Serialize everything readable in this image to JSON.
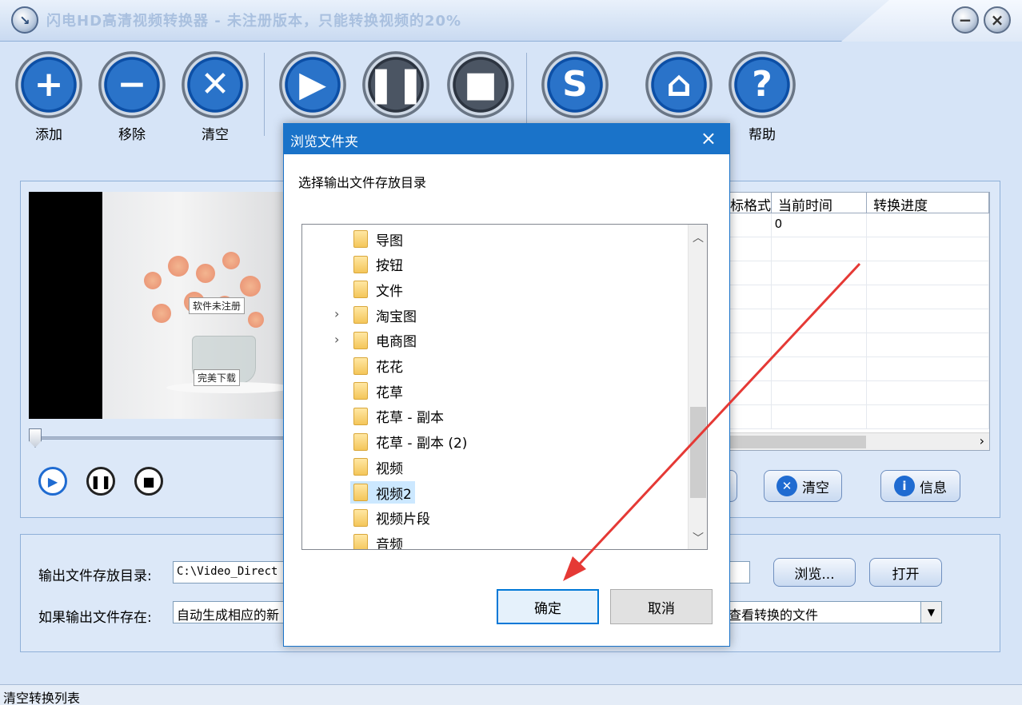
{
  "window": {
    "title": "闪电HD高清视频转换器 - 未注册版本，只能转换视频的20%",
    "icon": "app-logo-icon"
  },
  "toolbar": {
    "add_label": "添加",
    "remove_label": "移除",
    "clear_label": "清空",
    "help_label": "帮助"
  },
  "preview": {
    "watermark_top": "软件未注册",
    "watermark_bottom": "完美下载"
  },
  "filelist": {
    "columns": [
      "标格式",
      "当前时间",
      "转换进度"
    ],
    "rows": [
      {
        "format": "",
        "time": "0",
        "progress": ""
      }
    ]
  },
  "listbuttons": {
    "clear_label": "清空",
    "info_label": "信息"
  },
  "output": {
    "dir_label": "输出文件存放目录:",
    "dir_value": "C:\\Video_Direct",
    "browse_label": "浏览...",
    "open_label": "打开",
    "exists_label": "如果输出文件存在:",
    "exists_value": "自动生成相应的新",
    "after_value": "查看转换的文件"
  },
  "statusbar": {
    "text": "清空转换列表"
  },
  "dialog": {
    "title": "浏览文件夹",
    "prompt": "选择输出文件存放目录",
    "folders": [
      {
        "name": "导图",
        "expandable": false,
        "selected": false
      },
      {
        "name": "按钮",
        "expandable": false,
        "selected": false
      },
      {
        "name": "文件",
        "expandable": false,
        "selected": false
      },
      {
        "name": "淘宝图",
        "expandable": true,
        "selected": false
      },
      {
        "name": "电商图",
        "expandable": true,
        "selected": false
      },
      {
        "name": "花花",
        "expandable": false,
        "selected": false
      },
      {
        "name": "花草",
        "expandable": false,
        "selected": false
      },
      {
        "name": "花草 - 副本",
        "expandable": false,
        "selected": false
      },
      {
        "name": "花草 - 副本 (2)",
        "expandable": false,
        "selected": false
      },
      {
        "name": "视频",
        "expandable": false,
        "selected": false
      },
      {
        "name": "视频2",
        "expandable": false,
        "selected": true
      },
      {
        "name": "视频片段",
        "expandable": false,
        "selected": false
      },
      {
        "name": "音频",
        "expandable": false,
        "selected": false
      }
    ],
    "ok_label": "确定",
    "cancel_label": "取消"
  },
  "colors": {
    "accent": "#1a73c9",
    "annotation_arrow": "#e53935"
  }
}
